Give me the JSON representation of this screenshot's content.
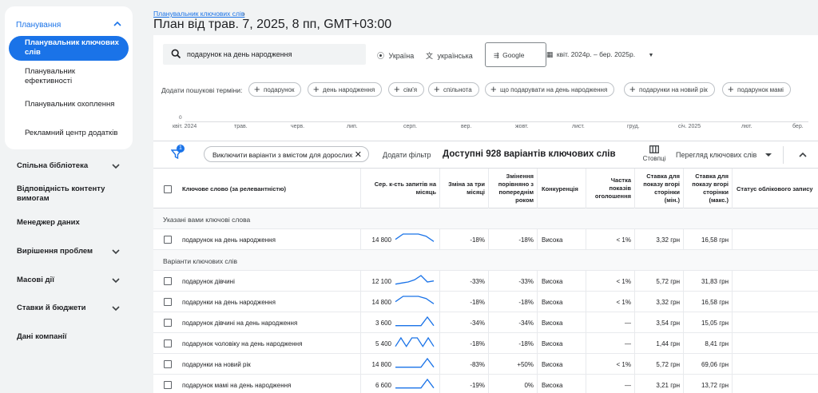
{
  "sidebar": {
    "planning_header": "Планування",
    "items": [
      {
        "label": "Планувальник ключових слів",
        "active": true
      },
      {
        "label": "Планувальник ефективності"
      },
      {
        "label": "Планувальник охоплення"
      },
      {
        "label": "Рекламний центр додатків"
      }
    ],
    "sections": [
      {
        "label": "Спільна бібліотека",
        "chevron": true
      },
      {
        "label": "Відповідність контенту вимогам",
        "chevron": false
      },
      {
        "label": "Менеджер даних",
        "chevron": false
      },
      {
        "label": "Вирішення проблем",
        "chevron": true
      },
      {
        "label": "Масові дії",
        "chevron": true
      },
      {
        "label": "Ставки й бюджети",
        "chevron": true
      },
      {
        "label": "Дані компанії",
        "chevron": false
      }
    ]
  },
  "header": {
    "breadcrumb": "Планувальник ключових слів",
    "title": "План від трав. 7, 2025, 8 пп, GMT+03:00"
  },
  "search": {
    "value": "подарунок на день народження",
    "location": "Україна",
    "language": "українська",
    "engine": "Google",
    "date_range": "квіт. 2024р. – бер. 2025р."
  },
  "terms": {
    "label": "Додати пошукові терміни:",
    "chips": [
      "подарунок",
      "день народження",
      "сім'я",
      "спільнота",
      "що подарувати на день народження",
      "подарунки на новий рік",
      "подарунок мамі"
    ]
  },
  "timeline": {
    "zero": "0",
    "months": [
      "квіт. 2024",
      "трав.",
      "черв.",
      "лип.",
      "серп.",
      "вер.",
      "жовт.",
      "лист.",
      "груд.",
      "січ. 2025",
      "лют.",
      "бер."
    ]
  },
  "toolbar": {
    "filter_count": "1",
    "adult_chip": "Виключити варіанти з вмістом для дорослих",
    "add_filter": "Додати фільтр",
    "available": "Доступні 928 варіантів ключових слів",
    "columns": "Стовпці",
    "view": "Перегляд ключових слів"
  },
  "table": {
    "headers": {
      "keyword": "Ключове слово (за релевантністю)",
      "avg_searches": "Сер. к-сть запитів на місяць",
      "three_month": "Зміна за три місяці",
      "yoy": "Змінення порівняно з попереднім роком",
      "competition": "Конкуренція",
      "impr_share": "Частка показів оголошення",
      "bid_low": "Ставка для показу вгорі сторінки (мін.)",
      "bid_high": "Ставка для показу вгорі сторінки (макс.)",
      "status": "Статус облікового запису"
    },
    "group_provided": "Указані вами ключові слова",
    "group_ideas": "Варіанти ключових слів",
    "provided_rows": [
      {
        "keyword": "подарунок на день народження",
        "searches": "14 800",
        "three": "-18%",
        "yoy": "-18%",
        "comp": "Висока",
        "share": "< 1%",
        "low": "3,32 грн",
        "high": "16,58 грн",
        "trend": [
          4,
          9,
          9,
          9,
          7,
          2
        ]
      }
    ],
    "idea_rows": [
      {
        "keyword": "подарунок дівчині",
        "searches": "12 100",
        "three": "-33%",
        "yoy": "-33%",
        "comp": "Висока",
        "share": "< 1%",
        "low": "5,72 грн",
        "high": "31,83 грн",
        "trend": [
          1,
          2,
          3,
          5,
          9,
          3,
          4
        ]
      },
      {
        "keyword": "подарунки на день народження",
        "searches": "14 800",
        "three": "-18%",
        "yoy": "-18%",
        "comp": "Висока",
        "share": "< 1%",
        "low": "3,32 грн",
        "high": "16,58 грн",
        "trend": [
          4,
          9,
          9,
          9,
          7,
          2
        ]
      },
      {
        "keyword": "подарунок дівчині на день народження",
        "searches": "3 600",
        "three": "-34%",
        "yoy": "-34%",
        "comp": "Висока",
        "share": "—",
        "low": "3,54 грн",
        "high": "15,05 грн",
        "trend": [
          1,
          1,
          1,
          1,
          1,
          9,
          1
        ]
      },
      {
        "keyword": "подарунок чоловіку на день народження",
        "searches": "5 400",
        "three": "-18%",
        "yoy": "-18%",
        "comp": "Висока",
        "share": "—",
        "low": "1,44 грн",
        "high": "8,41 грн",
        "trend": [
          1,
          9,
          1,
          9,
          9,
          1,
          9,
          1
        ]
      },
      {
        "keyword": "подарунки на новий рік",
        "searches": "14 800",
        "three": "-83%",
        "yoy": "+50%",
        "comp": "Висока",
        "share": "< 1%",
        "low": "5,72 грн",
        "high": "69,06 грн",
        "trend": [
          1,
          1,
          1,
          1,
          1,
          9,
          1
        ]
      },
      {
        "keyword": "подарунок мамі на день народження",
        "searches": "6 600",
        "three": "-19%",
        "yoy": "0%",
        "comp": "Висока",
        "share": "—",
        "low": "3,21 грн",
        "high": "13,72 грн",
        "trend": [
          1,
          1,
          1,
          1,
          1,
          9,
          1
        ]
      }
    ]
  },
  "colors": {
    "accent": "#1a73e8",
    "spark": "#1a73e8"
  }
}
